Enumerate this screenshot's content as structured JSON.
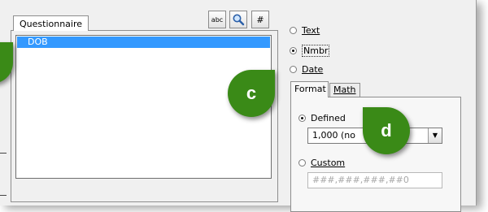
{
  "left_tab": {
    "label": "Questionnaire"
  },
  "list": {
    "items": [
      "DOB"
    ]
  },
  "toolbar": {
    "abc_label": "abc",
    "search_icon": "magnifier-icon",
    "hash_label": "#"
  },
  "type_options": [
    {
      "label": "Text",
      "checked": false
    },
    {
      "label": "Nmbr",
      "checked": true
    },
    {
      "label": "Date",
      "checked": false
    }
  ],
  "tabs": {
    "format": "Format",
    "math": "Math"
  },
  "format": {
    "defined_label": "Defined",
    "defined_checked": true,
    "defined_value": "1,000 (no",
    "custom_label": "Custom",
    "custom_checked": false,
    "custom_value": "###,###,###,##0"
  },
  "callouts": {
    "c": "c",
    "d": "d"
  },
  "colors": {
    "callout": "#3a8a17",
    "selection": "#3399ff"
  }
}
